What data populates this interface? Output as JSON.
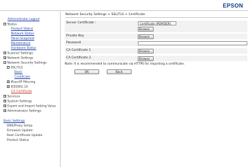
{
  "header": {
    "logo": "EPSON"
  },
  "sidebar": {
    "admin_logout": "Administrator Logout",
    "status": "Status",
    "status_items": [
      "Product Status",
      "Network Status",
      "Panel Snapshot",
      "Maintenance",
      "Hardware Status"
    ],
    "scanner_settings": "Scanner Settings",
    "network_settings": "Network Settings",
    "network_security_settings": "Network Security Settings",
    "ssl_tls": "SSL/TLS",
    "basic": "Basic",
    "certificate": "Certificate",
    "ipsec": "IPsec/IP Filtering",
    "ieee": "IEEE802.1X",
    "ca_certificate": "CA Certificate",
    "services": "Services",
    "system_settings": "System Settings",
    "export_import": "Export and Import Setting Value",
    "admin_settings": "Administrator Settings",
    "basic_settings": "Basic Settings",
    "basic_settings_items": [
      "DNS/Proxy Setup",
      "Firmware Update",
      "Root Certificate Update",
      "Product Status"
    ]
  },
  "main": {
    "breadcrumb": "Network Security Settings > SSL/TLS > Certificate",
    "server_certificate_label": "Server Certificate :",
    "server_certificate_value": "Certificate (PEM/DER)",
    "browse_label": "Browse...",
    "private_key_label": "Private Key",
    "password_label": "Password",
    "ca_cert1_label": "CA Certificate 1",
    "ca_cert2_label": "CA Certificate 2",
    "note": "Note: It is recommended to communicate via HTTPS for importing a certificate.",
    "ok_label": "OK",
    "back_label": "Back"
  }
}
